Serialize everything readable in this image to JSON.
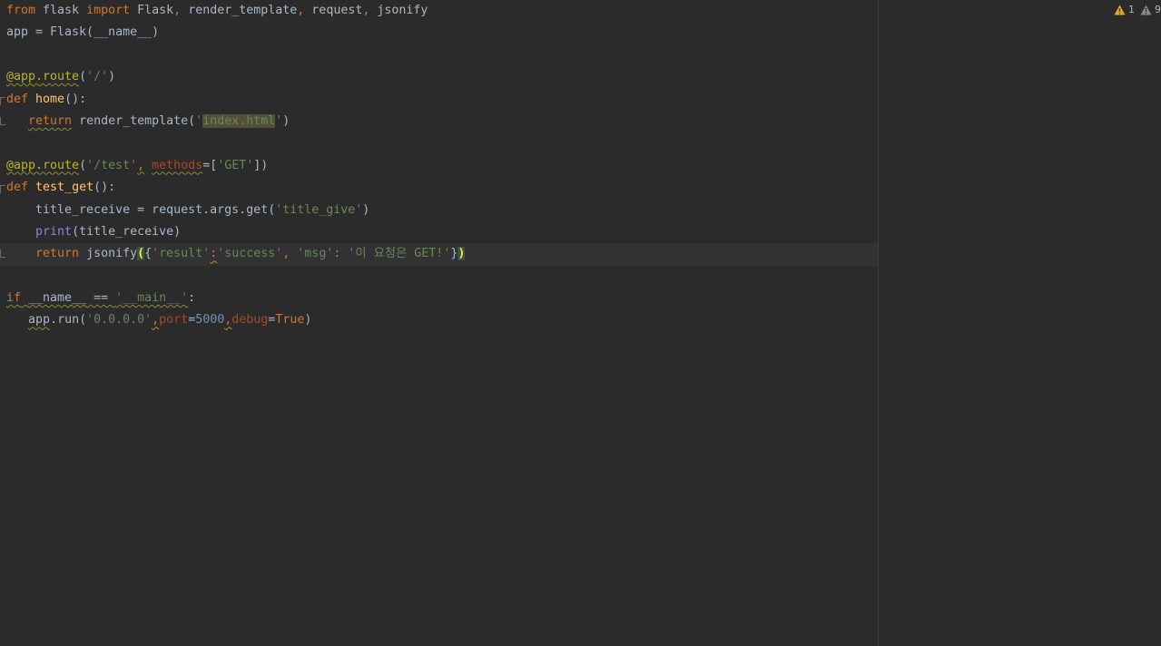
{
  "status": {
    "warnings_count": "1",
    "weak_warnings_count": "9",
    "warning_color": "#e0a82e",
    "weak_warning_color": "#888888"
  },
  "code": {
    "l1": {
      "from": "from",
      "module": " flask ",
      "import": "import",
      "names": " Flask",
      "c1": ",",
      "n2": " render_template",
      "c2": ",",
      "n3": " request",
      "c3": ",",
      "n4": " jsonify"
    },
    "l2": {
      "text": "app = Flask(__name__)"
    },
    "l4": {
      "deco": "@app.route",
      "open": "(",
      "str": "'/'",
      "close": ")"
    },
    "l5": {
      "def": "def",
      "fn": " home",
      "rest": "():"
    },
    "l6": {
      "indent": "   ",
      "ret": "return",
      "call": " render_template(",
      "q1": "'",
      "hl": "index.html",
      "q2": "'",
      "close": ")"
    },
    "l8": {
      "deco": "@app.route",
      "open": "(",
      "str": "'/test'",
      "comma": ",",
      "sp": " ",
      "param": "methods",
      "eq": "=[",
      "str2": "'GET'",
      "close": "])"
    },
    "l9": {
      "def": "def",
      "fn": " test_get",
      "rest": "():"
    },
    "l10": {
      "text": "    title_receive = request.args.get(",
      "str": "'title_give'",
      "close": ")"
    },
    "l11": {
      "indent": "    ",
      "print": "print",
      "rest": "(title_receive)"
    },
    "l12": {
      "indent": "    ",
      "ret": "return",
      "call": " jsonify",
      "open": "(",
      "brace": "{",
      "k1": "'result'",
      "colon1": ":",
      "v1": "'success'",
      "comma": ", ",
      "k2": "'msg'",
      "colon2": ": ",
      "v2": "'이 요청은 GET!'",
      "rbrace": "}",
      "close": ")"
    },
    "l14": {
      "if": "if",
      "sp": " ",
      "name": "__name__",
      "eq": " == ",
      "str": "'__main__'",
      "colon": ":"
    },
    "l15": {
      "indent": "   ",
      "app": "app",
      "run": ".run(",
      "str": "'0.0.0.0'",
      "c1": ",",
      "p1": "port",
      "eq1": "=",
      "num": "5000",
      "c2": ",",
      "p2": "debug",
      "eq2": "=",
      "val": "True",
      "close": ")"
    }
  }
}
